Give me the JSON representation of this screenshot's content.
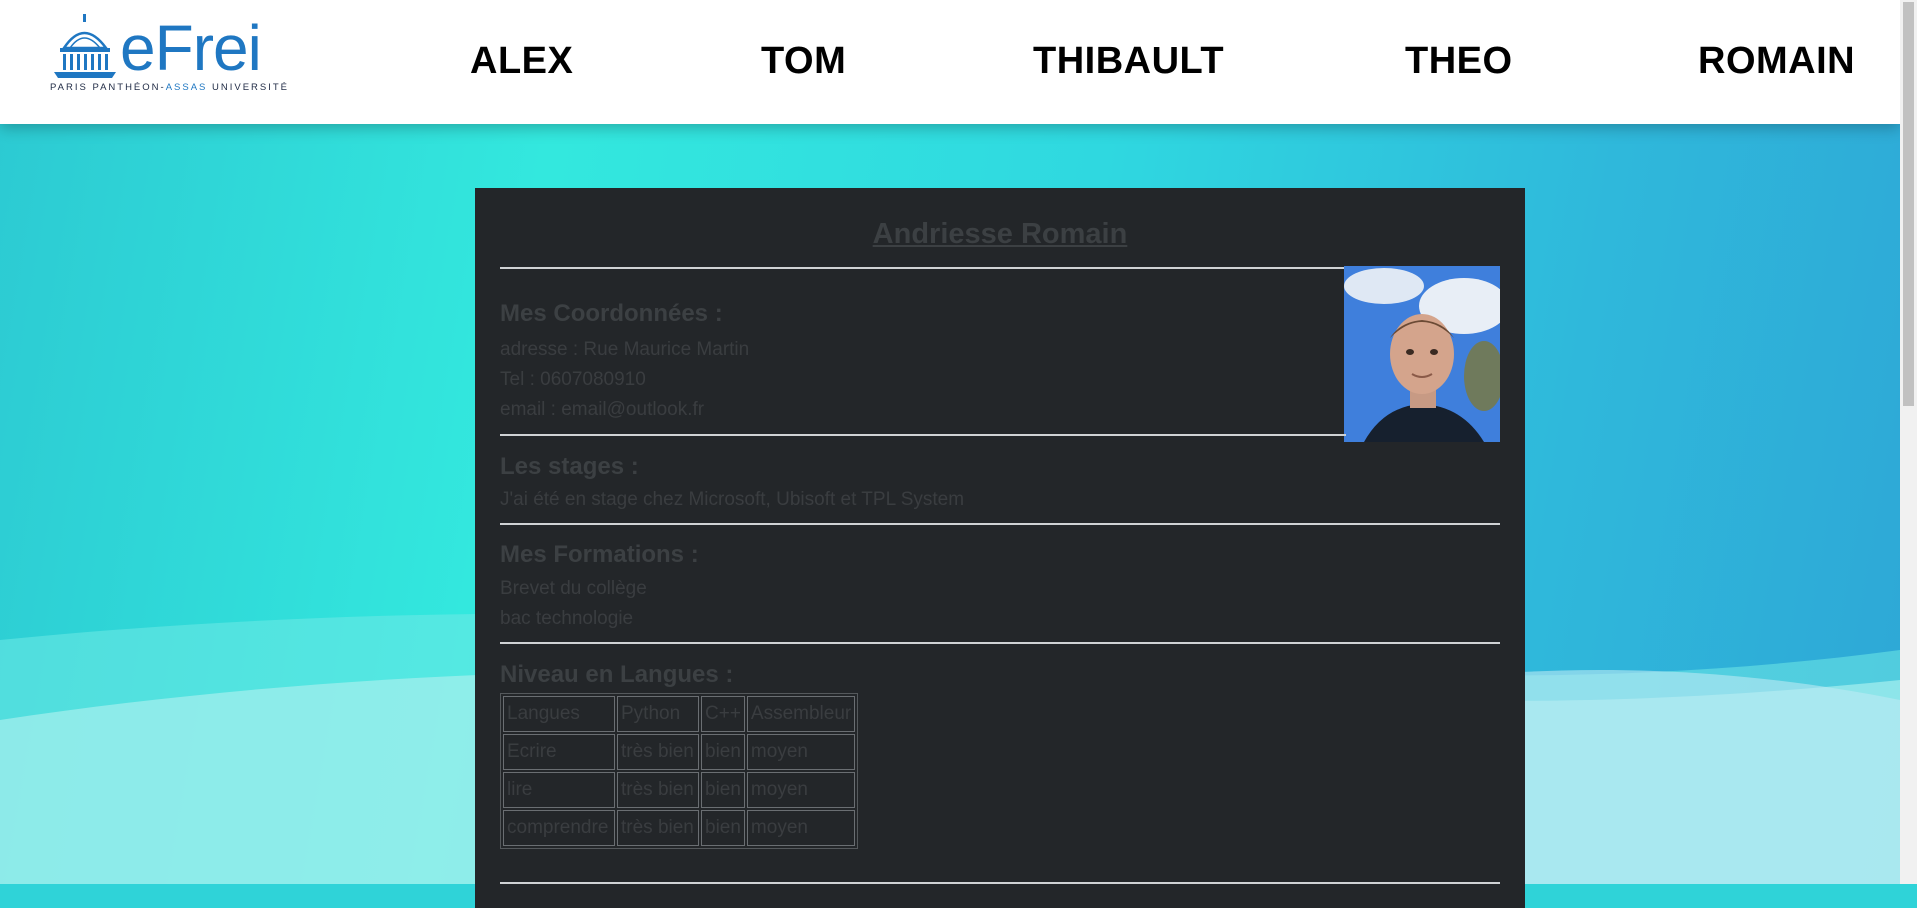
{
  "nav": {
    "logo_word": "eFrei",
    "logo_sub_left": "PARIS PANTHÉON-",
    "logo_sub_accent": "ASSAS",
    "logo_sub_right": " UNIVERSITÉ",
    "items": [
      "ALEX",
      "TOM",
      "THIBAULT",
      "THEO",
      "ROMAIN"
    ]
  },
  "profile": {
    "name": "Andriesse Romain",
    "contact": {
      "title": "Mes Coordonnées :",
      "address": "adresse : Rue Maurice Martin",
      "phone": "Tel : 0607080910",
      "email": "email : email@outlook.fr"
    },
    "internships": {
      "title": "Les stages :",
      "text": "J'ai été en stage chez Microsoft, Ubisoft et TPL System"
    },
    "education": {
      "title": "Mes Formations :",
      "items": [
        "Brevet du collège",
        "bac technologie"
      ]
    },
    "languages": {
      "title": "Niveau en Langues :",
      "header": [
        "Langues",
        "Python",
        "C++",
        "Assembleur"
      ],
      "rows": [
        [
          "Ecrire",
          "très bien",
          "bien",
          "moyen"
        ],
        [
          "lire",
          "très bien",
          "bien",
          "moyen"
        ],
        [
          "comprendre",
          "très bien",
          "bien",
          "moyen"
        ]
      ]
    }
  },
  "colors": {
    "brand": "#1f77c2",
    "card_bg": "#232629",
    "background": "#2fd3d8"
  }
}
